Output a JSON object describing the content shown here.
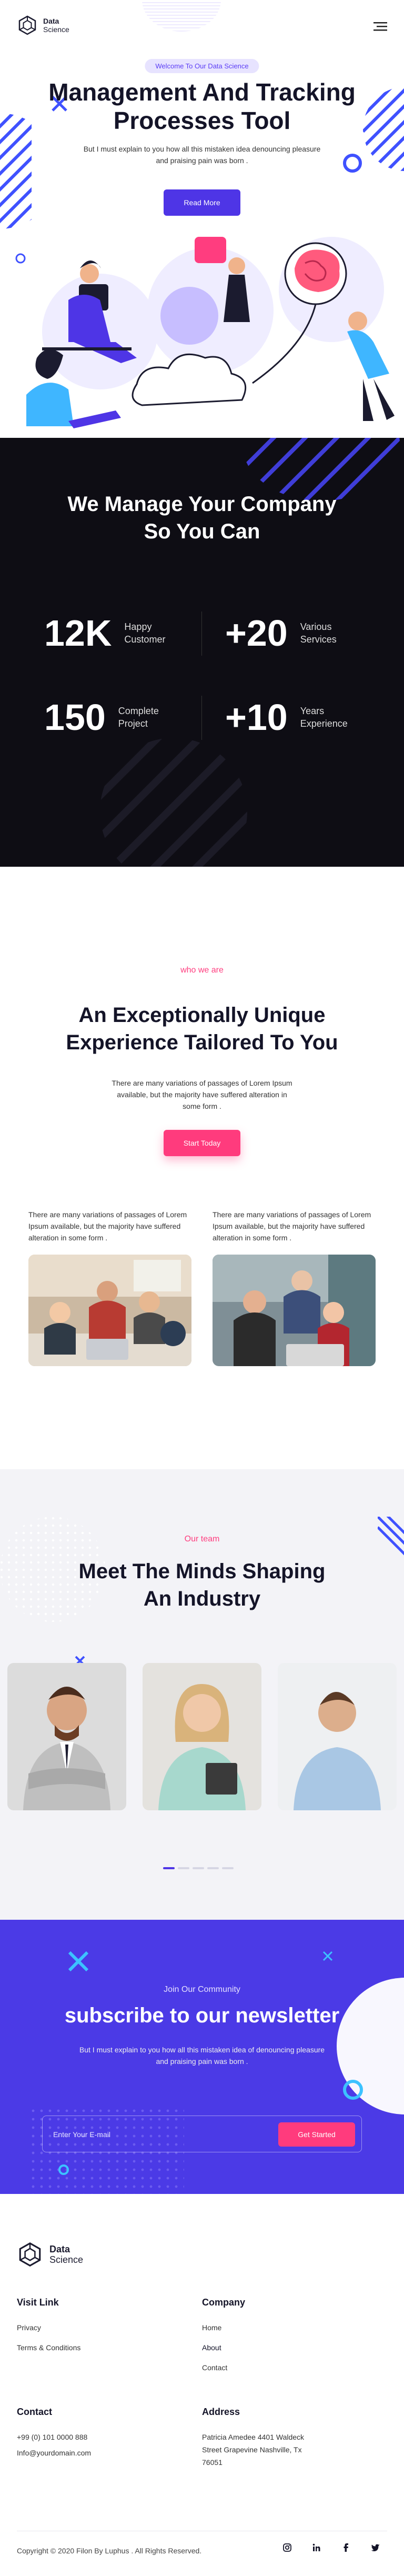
{
  "brand": {
    "name": "Data",
    "tagline": "Science"
  },
  "hero": {
    "badge": "Welcome To Our Data Science",
    "title_line1": "Management And Tracking",
    "title_line2": "Processes Tool",
    "subtitle": "But I must explain to you how all this mistaken idea denouncing pleasure and praising pain was born .",
    "cta": "Read More"
  },
  "stats": {
    "title_line1": "We Manage Your Company",
    "title_line2": "So You Can",
    "items": [
      {
        "value": "12K",
        "label1": "Happy",
        "label2": "Customer"
      },
      {
        "value": "+20",
        "label1": "Various",
        "label2": "Services"
      },
      {
        "value": "150",
        "label1": "Complete",
        "label2": "Project"
      },
      {
        "value": "+10",
        "label1": "Years",
        "label2": "Experience"
      }
    ]
  },
  "about": {
    "eyebrow": "who we are",
    "title_line1": "An Exceptionally Unique",
    "title_line2": "Experience Tailored To You",
    "subtitle": "There are many variations of passages of Lorem Ipsum available, but the majority have suffered alteration in some form .",
    "cta": "Start Today",
    "col1": "There are many variations of passages of Lorem Ipsum available, but the majority have suffered alteration in some form .",
    "col2": "There are many variations of passages of Lorem Ipsum available, but the majority have suffered alteration in some form ."
  },
  "team": {
    "eyebrow": "Our team",
    "title_line1": "Meet The Minds Shaping",
    "title_line2": "An Industry"
  },
  "newsletter": {
    "eyebrow": "Join Our Community",
    "title": "subscribe to our newsletter",
    "subtitle": "But I must explain to you how all this mistaken idea of denouncing pleasure and praising pain was born .",
    "placeholder": "Enter Your E-mail",
    "cta": "Get Started"
  },
  "footer": {
    "visit_heading": "Visit Link",
    "visit_links": [
      "Privacy",
      "Terms & Conditions"
    ],
    "company_heading": "Company",
    "company_links": [
      "Home",
      "About",
      "Contact"
    ],
    "contact_heading": "Contact",
    "phone": "+99 (0) 101 0000 888",
    "email": "Info@yourdomain.com",
    "address_heading": "Address",
    "address_line1": "Patricia Amedee 4401 Waldeck",
    "address_line2": "Street Grapevine Nashville, Tx",
    "address_line3": "76051",
    "copyright": "Copyright © 2020 Filon By Luphus . All Rights Reserved."
  },
  "colors": {
    "primary": "#4e35e6",
    "accent": "#ff3b7d",
    "dark": "#0e0d14"
  },
  "icons": [
    "hamburger-menu-icon",
    "instagram-icon",
    "linkedin-icon",
    "facebook-icon",
    "twitter-icon"
  ]
}
